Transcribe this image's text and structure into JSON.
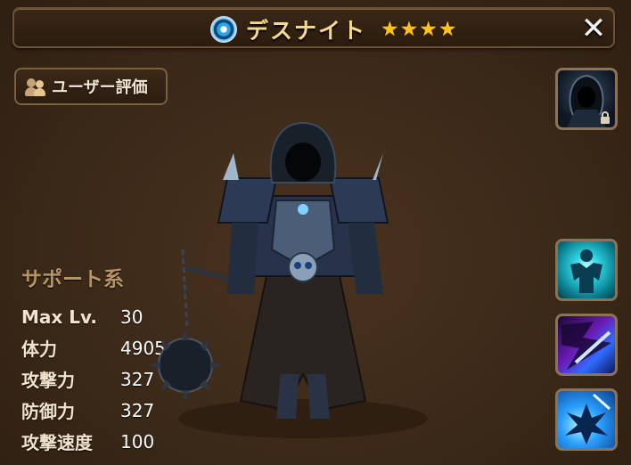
{
  "header": {
    "monster_name": "デスナイト",
    "element_icon": "water-element-icon",
    "star_count": 4,
    "stars": [
      "★",
      "★",
      "★",
      "★"
    ],
    "close_label": "✕"
  },
  "review_button": {
    "label": "ユーザー評価",
    "icon": "users-icon"
  },
  "portrait": {
    "icon": "portrait-icon",
    "lock_icon": "lock-icon"
  },
  "stats": {
    "category": "サポート系",
    "rows": [
      {
        "label": "Max Lv.",
        "value": "30"
      },
      {
        "label": "体力",
        "value": "4905"
      },
      {
        "label": "攻撃力",
        "value": "327"
      },
      {
        "label": "防御力",
        "value": "327"
      },
      {
        "label": "攻撃速度",
        "value": "100"
      }
    ]
  },
  "skills": [
    {
      "icon": "power-up-skill-icon"
    },
    {
      "icon": "dark-slash-skill-icon"
    },
    {
      "icon": "impact-skill-icon"
    }
  ],
  "colors": {
    "background": "#3d2a1a",
    "title_text": "#f6d98c",
    "star": "#ffc21a",
    "frame": "#8c7357",
    "category_text": "#b59466"
  }
}
